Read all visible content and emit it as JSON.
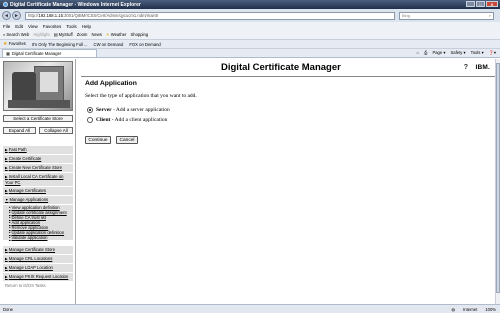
{
  "window": {
    "title": "Digital Certificate Manager - Windows Internet Explorer",
    "controls": [
      "_",
      "□",
      "X"
    ]
  },
  "address_bar": {
    "url_prefix": "http://",
    "url_domain": "192.168.1.15",
    "url_path": ":2001/QIBM/ICSS/Cert/Admin/qycucm1.ndm/main0",
    "search_placeholder": "Bing",
    "back": "◄",
    "forward": "►"
  },
  "menu": [
    "File",
    "Edit",
    "View",
    "Favorites",
    "Tools",
    "Help"
  ],
  "toolbar": {
    "search_web": "Search Web",
    "highlight": "Highlight",
    "mystuff": "MyStuff",
    "zoom": "Zoom",
    "news": "News",
    "weather": "Weather",
    "shopping": "Shopping"
  },
  "favorites_bar": {
    "favorites": "Favorites",
    "items": [
      "It's Only The Beginning Full ...",
      "CW on Demand",
      "FOX on Demand"
    ]
  },
  "tab": {
    "title": "Digital Certificate Manager"
  },
  "tab_tools": [
    "Page ▾",
    "Safety ▾",
    "Tools ▾",
    "❓▾"
  ],
  "sidebar": {
    "select_store_button": "Select a Certificate Store",
    "expand_all": "Expand All",
    "collapse_all": "Collapse All",
    "nav": [
      {
        "label": "Fast Path",
        "expanded": false
      },
      {
        "label": "Create Certificate",
        "expanded": false
      },
      {
        "label": "Create New Certificate Store",
        "expanded": false
      },
      {
        "label": "Install Local CA Certificate on Your PC",
        "expanded": false
      },
      {
        "label": "Manage Certificates",
        "expanded": false
      },
      {
        "label": "Manage Applications",
        "expanded": true,
        "children": [
          "View application definition",
          "Update certificate assignment",
          "Define CA trust list",
          "Add application",
          "Remove application",
          "Update application definition",
          "Validate application"
        ]
      },
      {
        "label": "Manage Certificate Store",
        "expanded": false
      },
      {
        "label": "Manage CRL Locations",
        "expanded": false
      },
      {
        "label": "Manage LDAP Location",
        "expanded": false
      },
      {
        "label": "Manage PKIX Request Location",
        "expanded": false
      }
    ],
    "return_link": "Return to i5/OS Tasks"
  },
  "main": {
    "header_title": "Digital Certificate Manager",
    "help": "?",
    "ibm": "IBM.",
    "page_title": "Add Application",
    "instruction": "Select the type of application that you want to add.",
    "options": [
      {
        "bold": "Server",
        "rest": " - Add a server application",
        "selected": true
      },
      {
        "bold": "Client",
        "rest": " - Add a client application",
        "selected": false
      }
    ],
    "continue_button": "Continue",
    "cancel_button": "Cancel"
  },
  "status": {
    "left": "Done",
    "zone": "Internet",
    "zoom": "100%"
  }
}
